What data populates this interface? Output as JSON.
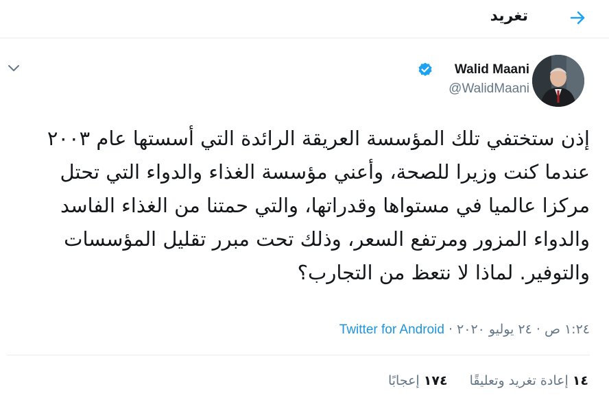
{
  "header": {
    "title": "تغريد"
  },
  "author": {
    "name": "Walid Maani",
    "handle": "@WalidMaani"
  },
  "tweet": {
    "text": "إذن ستختفي تلك المؤسسة العريقة الرائدة التي أسستها عام ٢٠٠٣ عندما كنت وزيرا للصحة، وأعني مؤسسة الغذاء والدواء التي تحتل مركزا عالميا في مستواها وقدراتها، والتي حمتنا من الغذاء الفاسد والدواء المزور ومرتفع السعر، وذلك تحت مبرر تقليل المؤسسات والتوفير. لماذا لا نتعظ من التجارب؟"
  },
  "meta": {
    "time": "١:٢٤ ص",
    "separator": "·",
    "date": "٢٤ يوليو ٢٠٢٠",
    "source": "Twitter for Android"
  },
  "stats": {
    "retweets_count": "١٤",
    "retweets_label": "إعادة تغريد وتعليقًا",
    "likes_count": "١٧٤",
    "likes_label": "إعجابًا"
  },
  "colors": {
    "accent": "#1da1f2",
    "link": "#1b95e0",
    "muted": "#657786",
    "text": "#14171a"
  },
  "icons": {
    "back": "arrow-right-icon",
    "more": "chevron-down-icon",
    "verified": "verified-badge-icon"
  }
}
